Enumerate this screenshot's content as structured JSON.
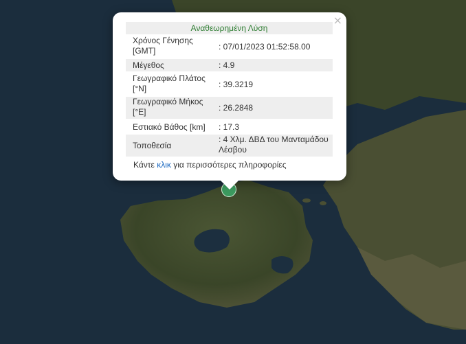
{
  "popup": {
    "title": "Αναθεωρημένη Λύση",
    "close_label": "×",
    "rows": [
      {
        "label": "Χρόνος Γένησης [GMT]",
        "value": ": 07/01/2023 01:52:58.00"
      },
      {
        "label": "Μέγεθος",
        "value": ": 4.9"
      },
      {
        "label": "Γεωγραφικό Πλάτος [°N]",
        "value": ": 39.3219"
      },
      {
        "label": "Γεωγραφικό Μήκος [°E]",
        "value": ": 26.2848"
      },
      {
        "label": "Εστιακό Βάθος [km]",
        "value": ": 17.3"
      },
      {
        "label": "Τοποθεσία",
        "value": ": 4 Χλμ. ΔΒΔ του Μανταμάδου Λέσβου"
      }
    ],
    "more_prefix": "Κάντε ",
    "more_link": "κλικ",
    "more_suffix": " για περισσότερες πληροφορίες"
  },
  "marker": {
    "color": "#3c9a5f",
    "icon": "earthquake-marker"
  },
  "colors": {
    "sea": "#1b2d3d",
    "land": "#3f4a2e",
    "title": "#2e7d32",
    "link": "#1565c0"
  }
}
